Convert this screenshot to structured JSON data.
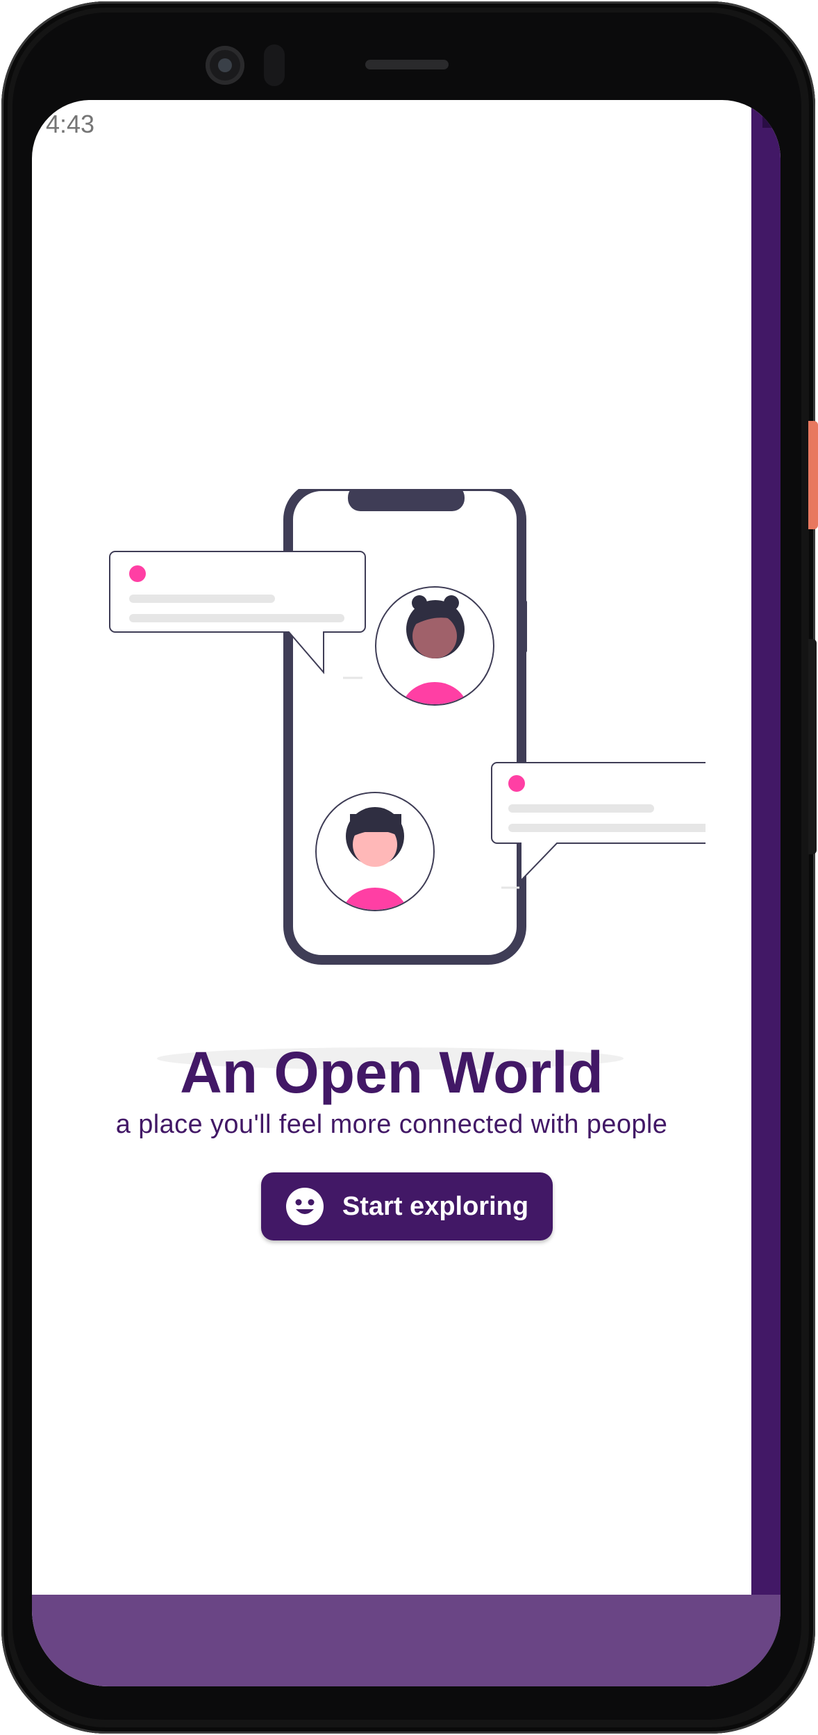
{
  "status_bar": {
    "time": "4:43"
  },
  "onboarding": {
    "title": "An Open World",
    "subtitle": "a place you'll feel more connected with people",
    "cta_label": "Start exploring",
    "cta_icon": "smiley-face-icon"
  },
  "colors": {
    "primary": "#421866",
    "nav_bar": "#6a4585",
    "accent_pink": "#ff3fa4",
    "phone_outline": "#3f3d56"
  }
}
